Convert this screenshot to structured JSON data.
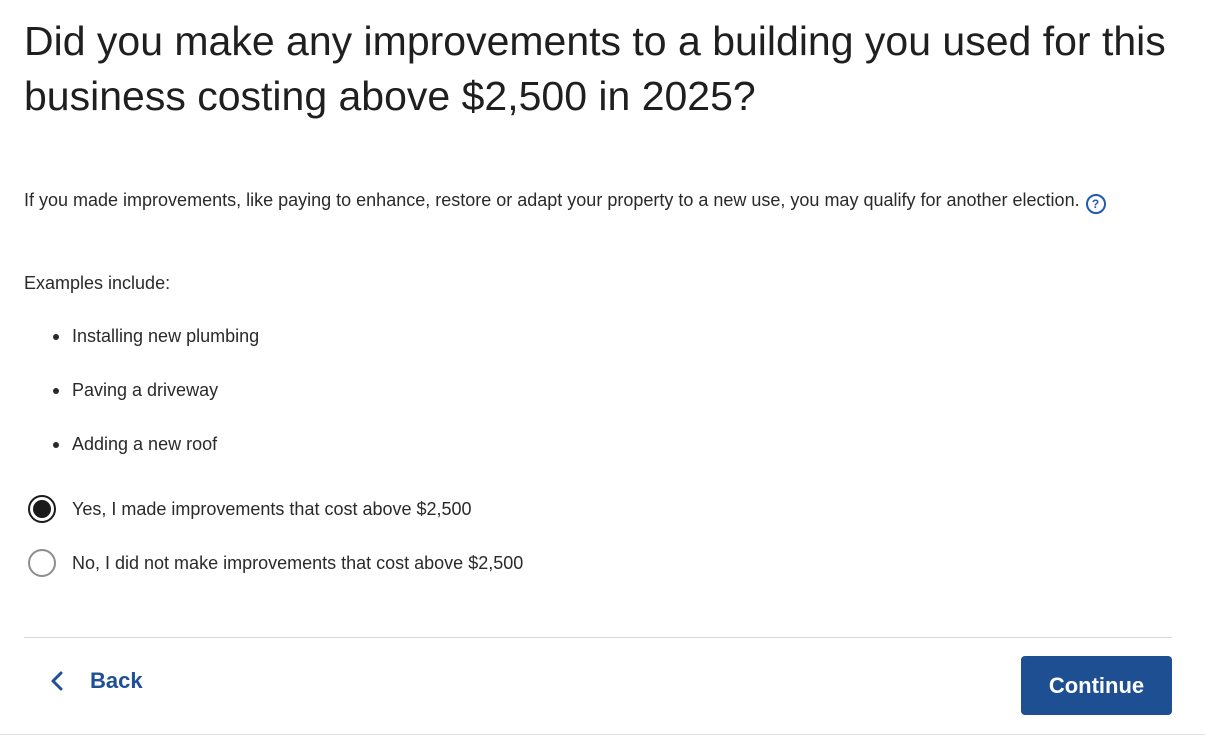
{
  "question": {
    "title": "Did you make any improvements to a building you used for this business costing above $2,500 in 2025?"
  },
  "intro": {
    "text": "If you made improvements, like paying to enhance, restore or adapt your property to a new use, you may qualify for another election.",
    "help_icon": "question-circle-icon",
    "help_glyph": "?"
  },
  "examples": {
    "label": "Examples include:",
    "items": [
      {
        "label": "Installing new plumbing"
      },
      {
        "label": "Paving a driveway"
      },
      {
        "label": "Adding a new roof"
      }
    ]
  },
  "options": [
    {
      "label": "Yes, I made improvements that cost above $2,500",
      "selected": true
    },
    {
      "label": "No, I did not make improvements that cost above $2,500",
      "selected": false
    }
  ],
  "navigation": {
    "back_label": "Back",
    "back_icon": "chevron-left-icon",
    "continue_label": "Continue"
  },
  "colors": {
    "primary": "#1e4f93",
    "link": "#1f4f95",
    "text": "#2a2a2a"
  }
}
